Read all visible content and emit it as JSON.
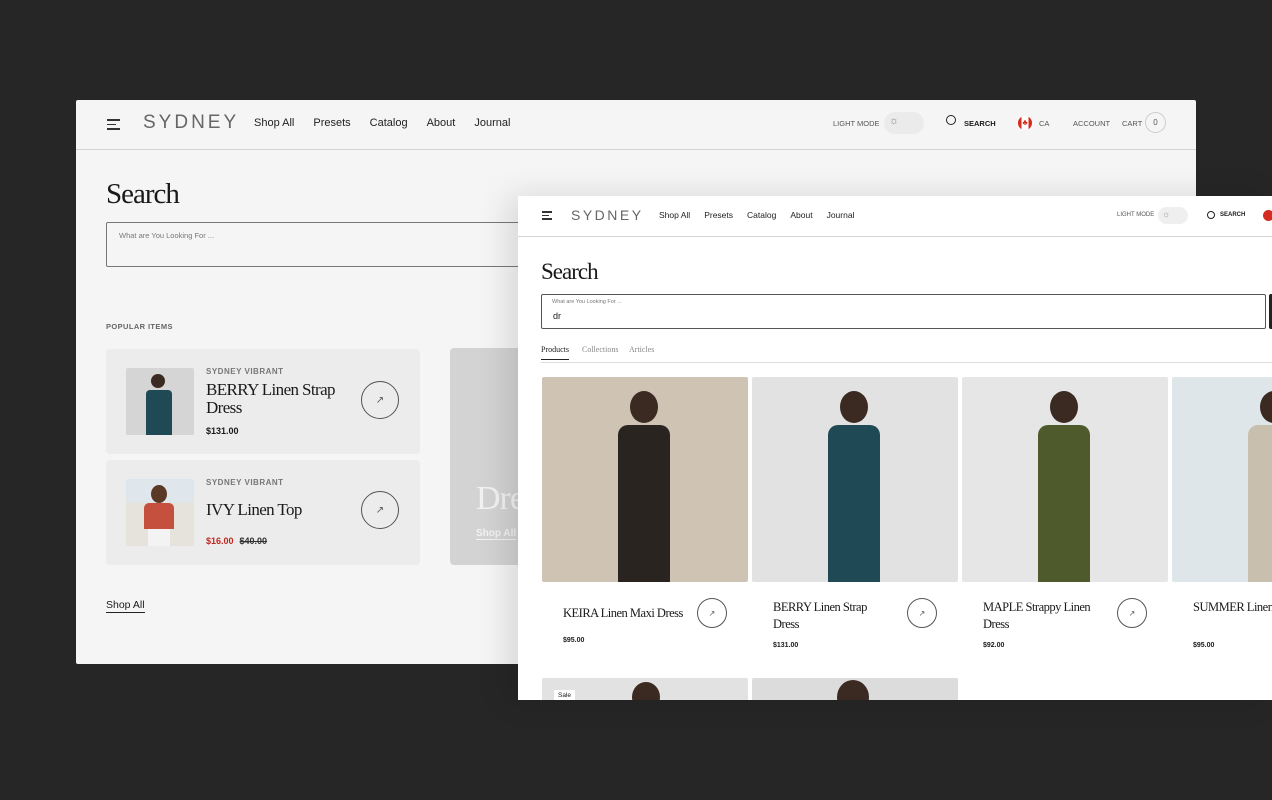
{
  "back": {
    "logo": "SYDNEY",
    "nav": [
      "Shop All",
      "Presets",
      "Catalog",
      "About",
      "Journal"
    ],
    "light_mode": "LIGHT MODE",
    "search": "SEARCH",
    "country": "CA",
    "account": "ACCOUNT",
    "cart": "CART",
    "cart_count": "0",
    "title": "Search",
    "placeholder": "What are You Looking For ...",
    "popular_label": "POPULAR ITEMS",
    "items": [
      {
        "brand": "SYDNEY VIBRANT",
        "name": "BERRY Linen Strap Dress",
        "price": "$131.00",
        "compare": ""
      },
      {
        "brand": "SYDNEY VIBRANT",
        "name": "IVY Linen Top",
        "price": "$16.00",
        "compare": "$40.00"
      }
    ],
    "collection": {
      "title": "Dresses",
      "link": "Shop All"
    },
    "shop_all": "Shop All"
  },
  "front": {
    "logo": "SYDNEY",
    "nav": [
      "Shop All",
      "Presets",
      "Catalog",
      "About",
      "Journal"
    ],
    "light_mode": "LIGHT MODE",
    "search": "SEARCH",
    "title": "Search",
    "placeholder": "What are You Looking For ...",
    "query": "dr",
    "tabs": [
      "Products",
      "Collections",
      "Articles"
    ],
    "active_tab": "Products",
    "products": [
      {
        "name": "KEIRA Linen Maxi Dress",
        "price": "$95.00",
        "color": "#2a2420",
        "bg": "#cfc4b4"
      },
      {
        "name": "BERRY Linen Strap Dress",
        "price": "$131.00",
        "color": "#1f4a55",
        "bg": "#e2e2e2"
      },
      {
        "name": "MAPLE Strappy Linen Dress",
        "price": "$92.00",
        "color": "#4e5a2c",
        "bg": "#e6e6e6"
      },
      {
        "name": "SUMMER Linen dress",
        "price": "$95.00",
        "color": "#c9bfae",
        "bg": "#dfe6ea"
      }
    ],
    "sale_badge": "Sale"
  },
  "colors": {
    "sale": "#c0281e",
    "bg": "#262626"
  }
}
